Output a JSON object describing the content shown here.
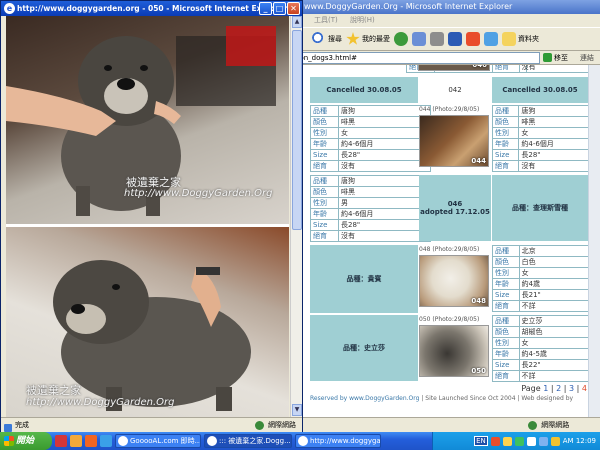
{
  "back_window": {
    "title": "www.DoggyGarden.Org - Microsoft Internet Explorer",
    "menu": [
      "工具(T)",
      "說明(H)"
    ],
    "toolbar": {
      "search": "搜尋",
      "favorites": "我的最愛",
      "folders": "資料夾"
    },
    "address": "bon_dogs3.html#",
    "go_label": "移至",
    "links_label": "連結",
    "status_zone": "網際網路"
  },
  "listing": {
    "top_row": {
      "age_label": "年齡",
      "age_value": "約4-6個月",
      "size_label": "Size",
      "size_value": "長28\"",
      "neuter_label": "絕育",
      "neuter_value": "沒有",
      "photo_num": "040"
    },
    "cancelled_left": "Cancelled 30.08.05",
    "id_042": "042",
    "cancelled_right": "Cancelled 30.08.05",
    "dog_044": {
      "photo_label": "044 (Photo:29/8/05)",
      "photo_num": "044",
      "fields": [
        {
          "k": "品種",
          "v": "唐狗"
        },
        {
          "k": "顏色",
          "v": "啡黑"
        },
        {
          "k": "性別",
          "v": "女"
        },
        {
          "k": "年齡",
          "v": "約4-6個月"
        },
        {
          "k": "Size",
          "v": "長28\""
        },
        {
          "k": "絕育",
          "v": "沒有"
        }
      ]
    },
    "dog_left_top": {
      "fields": [
        {
          "k": "品種",
          "v": "唐狗"
        },
        {
          "k": "顏色",
          "v": "啡黑"
        },
        {
          "k": "性別",
          "v": "女"
        },
        {
          "k": "年齡",
          "v": "約4-6個月"
        },
        {
          "k": "Size",
          "v": "長28\""
        },
        {
          "k": "絕育",
          "v": "沒有"
        }
      ]
    },
    "dog_left_mid": {
      "fields": [
        {
          "k": "品種",
          "v": "唐狗"
        },
        {
          "k": "顏色",
          "v": "啡黑"
        },
        {
          "k": "性別",
          "v": "男"
        },
        {
          "k": "年齡",
          "v": "約4-6個月"
        },
        {
          "k": "Size",
          "v": "長28\""
        },
        {
          "k": "絕育",
          "v": "沒有"
        }
      ]
    },
    "adopted_046": {
      "id": "046",
      "status": "adopted 17.12.05"
    },
    "breed_schnauzer": "品種：查理斯雪種",
    "breed_poodle": "品種：貴賓",
    "breed_shihtzu": "品種：史立莎",
    "dog_048": {
      "photo_label": "048 (Photo:29/8/05)",
      "photo_num": "048",
      "fields": [
        {
          "k": "品種",
          "v": "北京"
        },
        {
          "k": "顏色",
          "v": "白色"
        },
        {
          "k": "性別",
          "v": "女"
        },
        {
          "k": "年齡",
          "v": "約4歲"
        },
        {
          "k": "Size",
          "v": "長21\""
        },
        {
          "k": "絕育",
          "v": "不詳"
        }
      ]
    },
    "dog_050": {
      "photo_label": "050 (Photo:29/8/05)",
      "photo_num": "050",
      "fields": [
        {
          "k": "品種",
          "v": "史立莎"
        },
        {
          "k": "顏色",
          "v": "胡椒色"
        },
        {
          "k": "性別",
          "v": "女"
        },
        {
          "k": "年齡",
          "v": "約4-5歲"
        },
        {
          "k": "Size",
          "v": "長22\""
        },
        {
          "k": "絕育",
          "v": "不詳"
        }
      ]
    },
    "pager": {
      "label": "Page",
      "p1": "1",
      "sep": "|",
      "p2": "2",
      "p3": "3",
      "p4": "4"
    },
    "footer": {
      "brand": "Reserved by www.DoggyGarden.Org",
      "text": " | Site Launched Since Oct 2004 | Web designed by"
    }
  },
  "front_window": {
    "title": "http://www.doggygarden.org - 050 - Microsoft Internet Explorer",
    "watermark_cn": "被遺棄之家",
    "watermark_url": "http://www.DoggyGarden.Org",
    "status_done": "完成",
    "status_zone": "網際網路"
  },
  "taskbar": {
    "start": "開始",
    "tasks": [
      "GooooAL.com 即時...",
      "::: 被遺棄之家.Dogg...",
      "http://www.doggygard..."
    ],
    "lang": "EN",
    "clock": "AM 12:09"
  },
  "colors": {
    "teal": "#9fcfd3",
    "link": "#2a5db0",
    "current_page": "#e04b2a"
  }
}
